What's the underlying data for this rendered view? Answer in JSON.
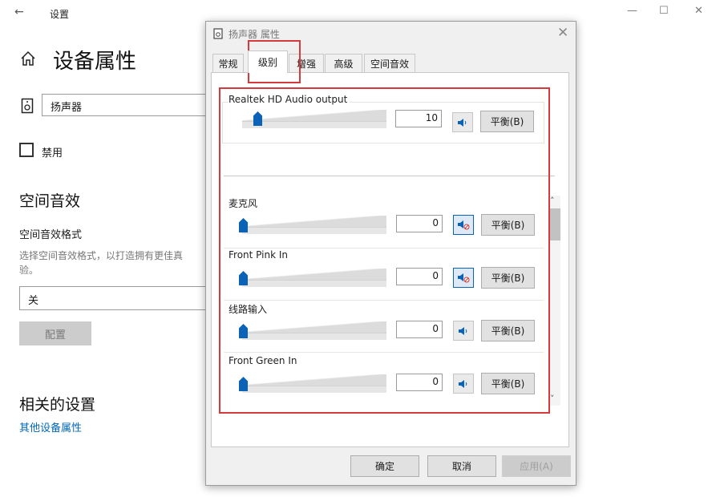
{
  "settings": {
    "back_arrow": "←",
    "app_title": "设置",
    "window_controls": [
      "—",
      "☐",
      "✕"
    ],
    "page_title": "设备属性",
    "device_name": "扬声器",
    "disable_label": "禁用",
    "spatial_heading": "空间音效",
    "spatial_format_label": "空间音效格式",
    "spatial_desc_line1": "选择空间音效格式，以打造拥有更佳真",
    "spatial_desc_line2": "验。",
    "spatial_select_value": "关",
    "configure_label": "配置",
    "related_heading": "相关的设置",
    "related_link": "其他设备属性"
  },
  "dialog": {
    "title": "扬声器 属性",
    "close": "✕",
    "tabs": [
      {
        "label": "常规",
        "active": false
      },
      {
        "label": "级别",
        "active": true
      },
      {
        "label": "增强",
        "active": false
      },
      {
        "label": "高级",
        "active": false
      },
      {
        "label": "空间音效",
        "active": false
      }
    ],
    "output": {
      "label": "Realtek HD Audio output",
      "value": "10",
      "balance_label": "平衡(B)",
      "muted": false
    },
    "inputs": [
      {
        "label": "麦克风",
        "value": "0",
        "balance_label": "平衡(B)",
        "muted": true
      },
      {
        "label": "Front Pink In",
        "value": "0",
        "balance_label": "平衡(B)",
        "muted": true
      },
      {
        "label": "线路输入",
        "value": "0",
        "balance_label": "平衡(B)",
        "muted": false
      },
      {
        "label": "Front Green In",
        "value": "0",
        "balance_label": "平衡(B)",
        "muted": false
      }
    ],
    "scroll_up": "˄",
    "scroll_down": "˅",
    "buttons": {
      "ok": "确定",
      "cancel": "取消",
      "apply": "应用(A)"
    }
  },
  "colors": {
    "accent": "#0b63b8",
    "highlight": "#d63a3a",
    "link": "#0067b8"
  },
  "icons": [
    "back-arrow-icon",
    "home-icon",
    "speaker-device-icon",
    "speaker-icon",
    "speaker-muted-icon",
    "close-icon"
  ]
}
